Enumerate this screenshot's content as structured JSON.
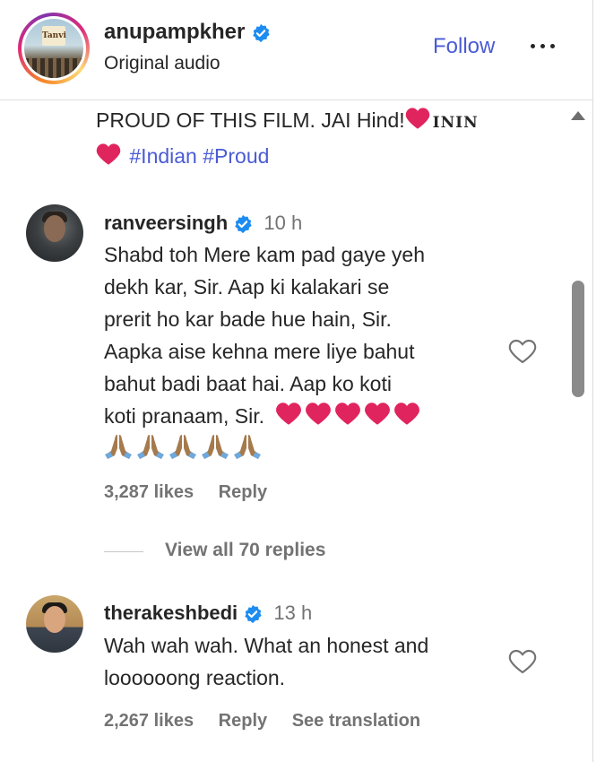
{
  "post": {
    "username": "anupampkher",
    "subtitle": "Original audio",
    "follow_label": "Follow",
    "avatar_poster_text": "Tanvi",
    "caption_text": "PROUD OF THIS FILM. JAI Hind!",
    "caption_brand": "ININ",
    "hashtags": "#Indian #Proud"
  },
  "comments": [
    {
      "username": "ranveersingh",
      "time": "10 h",
      "lines": [
        "Shabd toh Mere kam pad gaye yeh",
        "dekh kar, Sir. Aap ki kalakari se",
        "prerit ho kar bade hue hain, Sir.",
        "Aapka aise kehna mere liye bahut",
        "bahut badi baat hai. Aap ko koti",
        "koti pranaam, Sir."
      ],
      "likes": "3,287 likes",
      "reply_label": "Reply",
      "view_replies": "View all 70 replies"
    },
    {
      "username": "therakeshbedi",
      "time": "13 h",
      "lines": [
        "Wah wah wah. What an honest and",
        "loooooong reaction."
      ],
      "likes": "2,267 likes",
      "reply_label": "Reply",
      "translation_label": "See translation"
    }
  ],
  "icons": {
    "verified": "verified-badge-icon",
    "more": "more-options-icon",
    "heart": "heart-outline-icon",
    "red_heart": "red-heart-emoji",
    "pray": "folded-hands-emoji"
  },
  "colors": {
    "link_blue": "#4a5bd4",
    "verified_blue": "#1d8cf0",
    "muted_text": "#737373",
    "emoji_red": "#e0245e"
  }
}
